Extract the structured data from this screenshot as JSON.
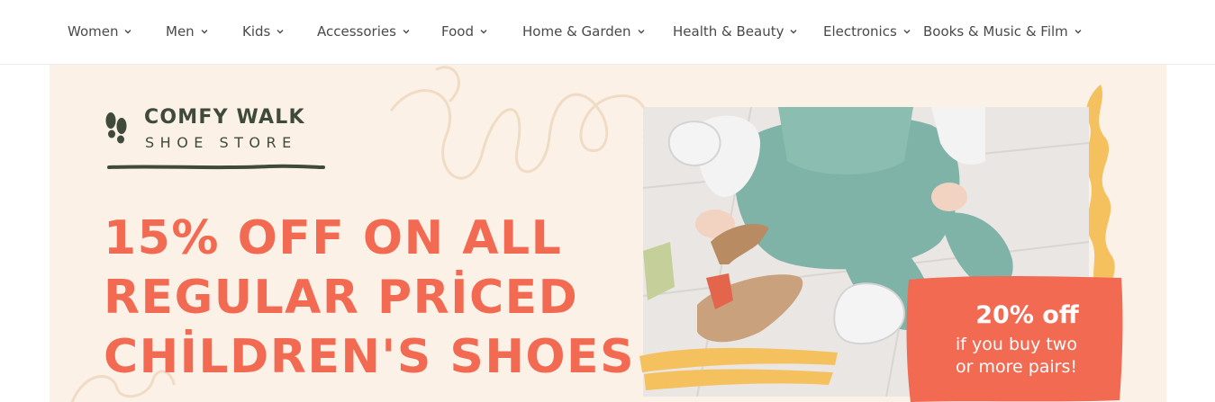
{
  "nav": {
    "items": [
      {
        "label": "Women"
      },
      {
        "label": "Men"
      },
      {
        "label": "Kids"
      },
      {
        "label": "Accessories"
      },
      {
        "label": "Food"
      },
      {
        "label": "Home & Garden"
      },
      {
        "label": "Health & Beauty"
      },
      {
        "label": "Electronics"
      },
      {
        "label": "Books & Music & Film"
      }
    ],
    "dropdown_icon": "chevron-down-icon"
  },
  "banner": {
    "logo": {
      "title": "COMFY WALK",
      "subtitle": "SHOE STORE",
      "icon": "footprints-icon"
    },
    "headline": {
      "line1": "15% OFF ON ALL",
      "line2": "REGULAR PRİCED",
      "line3": "CHİLDREN'S SHOES"
    },
    "offer": {
      "title": "20% off",
      "line1": "if you buy two",
      "line2": "or more pairs!"
    },
    "colors": {
      "background": "#fbf1e7",
      "accent": "#f26a52",
      "logo": "#3f4a3b",
      "highlight": "#f5c15f"
    }
  }
}
